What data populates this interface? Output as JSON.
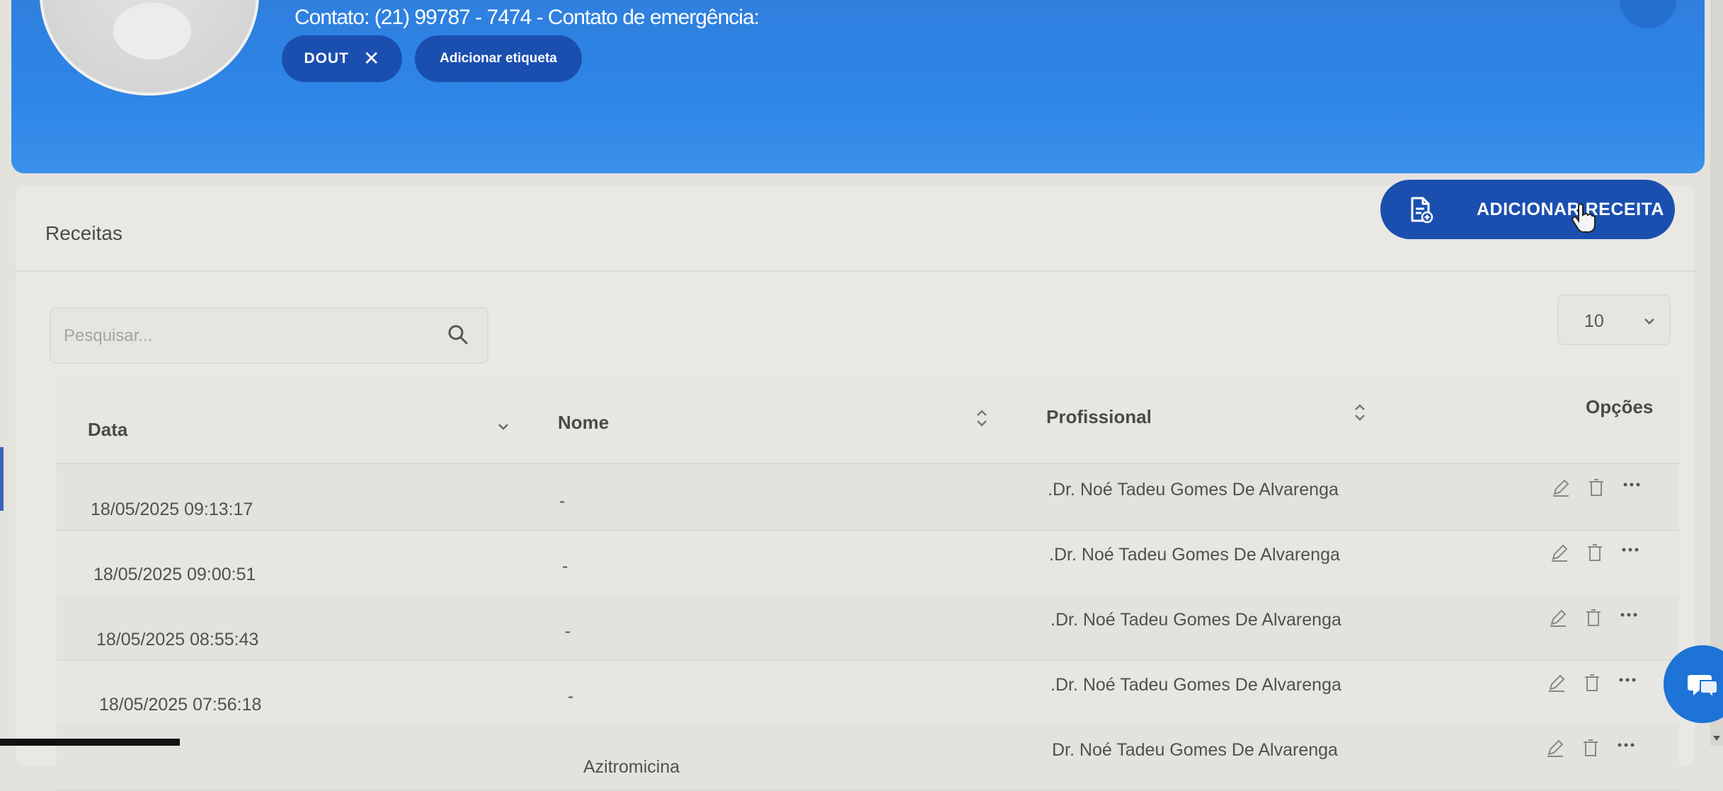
{
  "header": {
    "contact_line": "Contato: (21) 99787 - 7474 - Contato de emergência:",
    "tags": [
      {
        "label": "DOUT",
        "removable": true
      }
    ],
    "add_tag_label": "Adicionar etiqueta"
  },
  "section": {
    "title": "Receitas",
    "add_button_label": "ADICIONAR RECEITA",
    "search_placeholder": "Pesquisar...",
    "page_size": "10"
  },
  "table": {
    "columns": {
      "date": "Data",
      "name": "Nome",
      "professional": "Profissional",
      "options": "Opções"
    },
    "rows": [
      {
        "date": "18/05/2025 09:13:17",
        "name": "-",
        "professional": ".Dr. Noé Tadeu Gomes De Alvarenga"
      },
      {
        "date": "18/05/2025 09:00:51",
        "name": "-",
        "professional": ".Dr. Noé Tadeu Gomes De Alvarenga"
      },
      {
        "date": "18/05/2025 08:55:43",
        "name": "-",
        "professional": ".Dr. Noé Tadeu Gomes De Alvarenga"
      },
      {
        "date": "18/05/2025 07:56:18",
        "name": "-",
        "professional": ".Dr. Noé Tadeu Gomes De Alvarenga"
      },
      {
        "date": "",
        "name": "Azitromicina",
        "professional": "Dr. Noé Tadeu Gomes De Alvarenga"
      }
    ]
  },
  "colors": {
    "banner_blue": "#2e86e6",
    "chip_navy": "#1a4fb0",
    "page_bg": "#e4e2dd"
  },
  "icons": {
    "close": "close-icon",
    "document": "document-add-icon",
    "search": "search-icon",
    "chevron": "chevron-down-icon",
    "sort": "sort-icon",
    "edit": "pencil-icon",
    "delete": "trash-icon",
    "more": "more-dots-icon",
    "chat": "chat-icon"
  }
}
